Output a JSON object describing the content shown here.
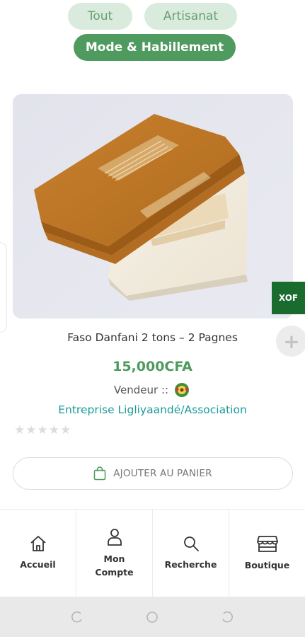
{
  "categories": [
    {
      "label": "Tout",
      "active": false
    },
    {
      "label": "Artisanat",
      "active": false
    },
    {
      "label": "Mode & Habillement",
      "active": true
    }
  ],
  "product": {
    "title": "Faso Danfani 2 tons – 2 Pagnes",
    "price": "15,000CFA",
    "vendor_label": "Vendeur ::",
    "vendor_name": "Entreprise Ligliyaandé/Association",
    "rating": 0,
    "rating_max": 5,
    "add_to_cart": "AJOUTER AU PANIER"
  },
  "currency_badge": "XOF",
  "plus_button": "+",
  "nav": [
    {
      "label": "Accueil",
      "icon": "home-icon"
    },
    {
      "label": "Mon Compte",
      "icon": "user-icon"
    },
    {
      "label": "Recherche",
      "icon": "search-icon"
    },
    {
      "label": "Boutique",
      "icon": "store-icon"
    }
  ],
  "colors": {
    "accent": "#4f9a5e",
    "chip_light": "#d9ebdc",
    "vendor_link": "#1a9b9b",
    "badge": "#1a6b2e"
  }
}
